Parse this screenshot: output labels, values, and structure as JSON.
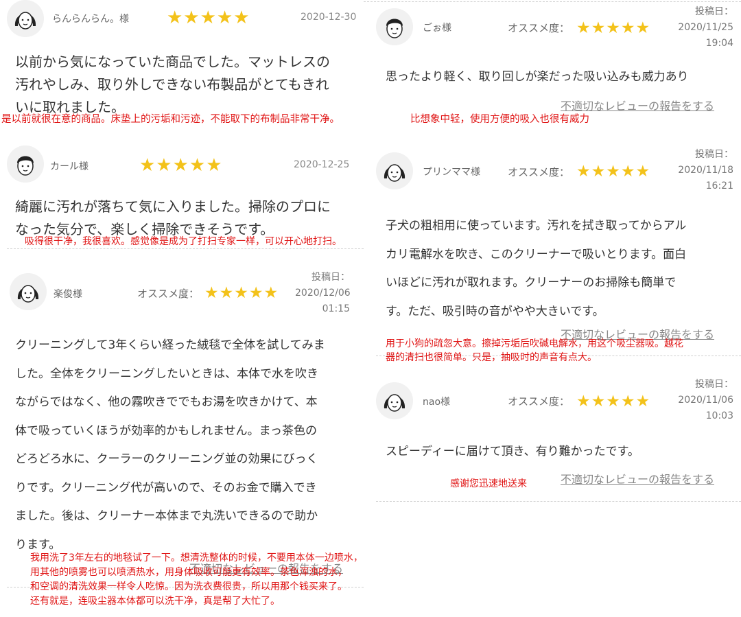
{
  "left": {
    "r1": {
      "name": "らんらんらん。様",
      "stars": "★★★★★",
      "date": "2020-12-30",
      "lines": [
        "以前から気になっていた商品でした。マットレスの",
        "汚れやしみ、取り外しできない布製品がとてもきれ",
        "いに取れました。"
      ],
      "translation": "是以前就很在意的商品。床垫上的污垢和污迹，不能取下的布制品非常干净。"
    },
    "r2": {
      "name": "カール様",
      "stars": "★★★★★",
      "date": "2020-12-25",
      "lines": [
        "綺麗に汚れが落ちて気に入りました。掃除のプロに",
        "なった気分で、楽しく掃除できそうです。"
      ],
      "translation": "吸得很干净，我很喜欢。感觉像是成为了打扫专家一样，可以开心地打扫。"
    },
    "r3": {
      "name": "楽俊様",
      "rec_label": "オススメ度：",
      "stars": "★★★★★",
      "posted_label": "投稿日：",
      "posted_date": "2020/12/06",
      "posted_time": "01:15",
      "lines": [
        "クリーニングして3年くらい経った絨毯で全体を試してみま",
        "した。全体をクリーニングしたいときは、本体で水を吹き",
        "ながらではなく、他の霧吹きででもお湯を吹きかけて、本",
        "体で吸っていくほうが効率的かもしれません。まっ茶色の",
        "どろどろ水に、クーラーのクリーニング並の効果にびっく",
        "りです。クリーニング代が高いので、そのお金で購入でき",
        "ました。後は、クリーナー本体まで丸洗いできるので助か",
        "ります。"
      ],
      "report": "不適切なレビューの報告をする",
      "translation": [
        "我用洗了3年左右的地毯试了一下。想清洗整体的时候，不要用本体一边喷水，",
        "用其他的喷雾也可以喷洒热水，用身体吸收可能更有效率。茶色浑浊的水，",
        "和空调的清洗效果一样令人吃惊。因为洗衣费很贵，所以用那个钱买来了。",
        "还有就是，连吸尘器本体都可以洗干净，真是帮了大忙了。"
      ]
    }
  },
  "right": {
    "r1": {
      "name": "ごぉ様",
      "rec_label": "オススメ度：",
      "stars": "★★★★★",
      "posted_label": "投稿日：",
      "posted_date": "2020/11/25",
      "posted_time": "19:04",
      "lines": [
        "思ったより軽く、取り回しが楽だった吸い込みも威力あり"
      ],
      "report": "不適切なレビューの報告をする",
      "translation": "比想象中轻，使用方便的吸入也很有威力"
    },
    "r2": {
      "name": "プリンママ様",
      "rec_label": "オススメ度：",
      "stars": "★★★★★",
      "posted_label": "投稿日：",
      "posted_date": "2020/11/18",
      "posted_time": "16:21",
      "lines": [
        "子犬の粗相用に使っています。汚れを拭き取ってからアル",
        "カリ電解水を吹き、このクリーナーで吸いとります。面白",
        "いほどに汚れが取れます。クリーナーのお掃除も簡単で",
        "す。ただ、吸引時の音がやや大きいです。"
      ],
      "report": "不適切なレビューの報告をする",
      "translation": [
        "用于小狗的疏忽大意。擦掉污垢后吹碱电解水，用这个吸尘器吸。越花",
        "器的清扫也很简单。只是，抽吸时的声音有点大。"
      ]
    },
    "r3": {
      "name": "nao様",
      "rec_label": "オススメ度：",
      "stars": "★★★★★",
      "posted_label": "投稿日：",
      "posted_date": "2020/11/06",
      "posted_time": "10:03",
      "lines": [
        "スピーディーに届けて頂き、有り難かったです。"
      ],
      "report": "不適切なレビューの報告をする",
      "translation": "感谢您迅速地送来"
    }
  },
  "colors": {
    "star": "#f3c21a",
    "translation": "#e01414",
    "divider": "#cfcfcf"
  },
  "icons": {
    "avatar_female": "woman-avatar-icon",
    "avatar_male": "man-avatar-icon"
  }
}
